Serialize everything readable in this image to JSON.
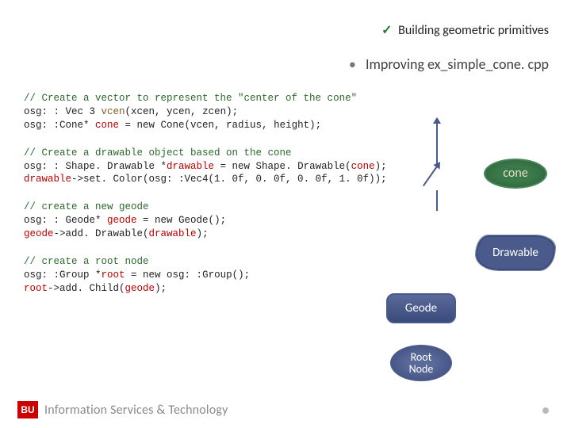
{
  "header": {
    "check_label": "Building geometric primitives",
    "bullet_label": "Improving ex_simple_cone. cpp"
  },
  "code": {
    "block1": {
      "c1": "// Create a vector to represent the \"center of the cone\"",
      "l2a": "osg: : Vec 3 ",
      "l2b": "vcen",
      "l2c": "(xcen, ycen, zcen);",
      "l3a": "osg: :Cone* ",
      "l3b": "cone",
      "l3c": " = new Cone(vcen, radius, height);"
    },
    "block2": {
      "c1": "// Create a drawable object based on the cone",
      "l2a": "osg: : Shape. Drawable *",
      "l2b": "drawable",
      "l2c": " = new Shape. Drawable(",
      "l2d": "cone",
      "l2e": ");",
      "l3a": "drawable",
      "l3b": "->set. Color(osg: :Vec4(1. 0f, 0. 0f, 0. 0f, 1. 0f));"
    },
    "block3": {
      "c1": "// create a new geode",
      "l2a": "osg: : Geode* ",
      "l2b": "geode",
      "l2c": " = new Geode();",
      "l3a": "geode",
      "l3b": "->add. Drawable(",
      "l3c": "drawable",
      "l3d": ");"
    },
    "block4": {
      "c1": "// create a root node",
      "l2a": "osg: :Group *",
      "l2b": "root",
      "l2c": " = new osg: :Group();",
      "l3a": "root",
      "l3b": "->add. Child(",
      "l3c": "geode",
      "l3d": ");"
    }
  },
  "diagram": {
    "cone": "cone",
    "drawable": "Drawable",
    "geode": "Geode",
    "root": "Root\nNode"
  },
  "footer": {
    "logo": "BU",
    "text": "Information Services & Technology"
  }
}
